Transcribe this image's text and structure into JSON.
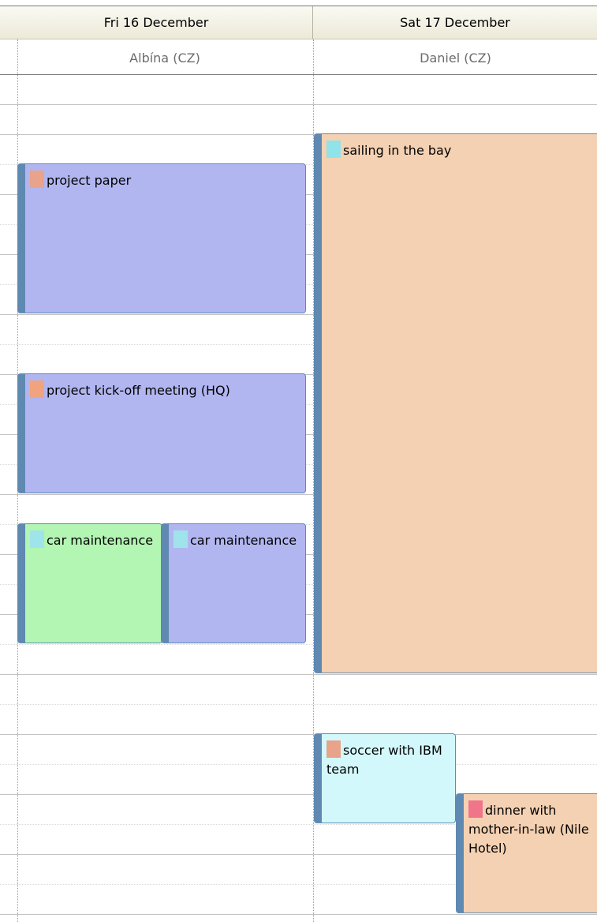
{
  "days": [
    {
      "header": "Fri 16 December",
      "resource": "Albína (CZ)"
    },
    {
      "header": "Sat 17 December",
      "resource": "Daniel (CZ)"
    }
  ],
  "events": {
    "project_paper": {
      "title": "project paper",
      "tag_color": "#e8a38a",
      "bg": "#b2b6f0"
    },
    "kickoff": {
      "title": "project kick-off meeting (HQ)",
      "tag_color": "#f0a37e",
      "bg": "#b2b6f0"
    },
    "car_a": {
      "title": "car maintenance",
      "tag_color": "#9ee4ea",
      "bg": "#b3f5b3"
    },
    "car_b": {
      "title": "car maintenance",
      "tag_color": "#9ee4ea",
      "bg": "#b2b6f0"
    },
    "sailing": {
      "title": "sailing in the bay",
      "tag_color": "#8fe3e9",
      "bg": "#f4d1b2"
    },
    "soccer": {
      "title": "soccer with IBM team",
      "tag_color": "#e8a38a",
      "bg": "#d3f8fb"
    },
    "dinner": {
      "title": "dinner with mother-in-law (Nile Hotel)",
      "tag_color": "#f0758a",
      "bg": "#f4d1b2"
    }
  }
}
